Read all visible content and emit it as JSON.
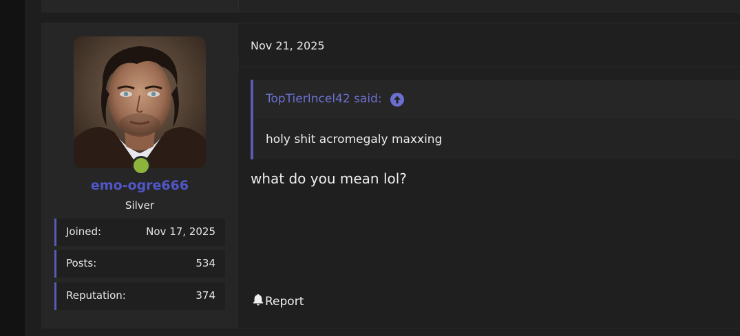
{
  "post": {
    "user": {
      "username": "emo-ogre666",
      "rank": "Silver",
      "online": true,
      "avatar_alt": "avatar",
      "stats": [
        {
          "label": "Joined:",
          "value": "Nov 17, 2025"
        },
        {
          "label": "Posts:",
          "value": "534"
        },
        {
          "label": "Reputation:",
          "value": "374"
        }
      ]
    },
    "date": "Nov 21, 2025",
    "quote": {
      "author": "TopTierIncel42 said:",
      "text": "holy shit acromegaly maxxing"
    },
    "message": "what do you mean lol?",
    "actions": {
      "report_label": "Report"
    }
  },
  "colors": {
    "accent": "#5156c7",
    "online": "#8db53b",
    "quote_border": "#5a5cb0"
  }
}
